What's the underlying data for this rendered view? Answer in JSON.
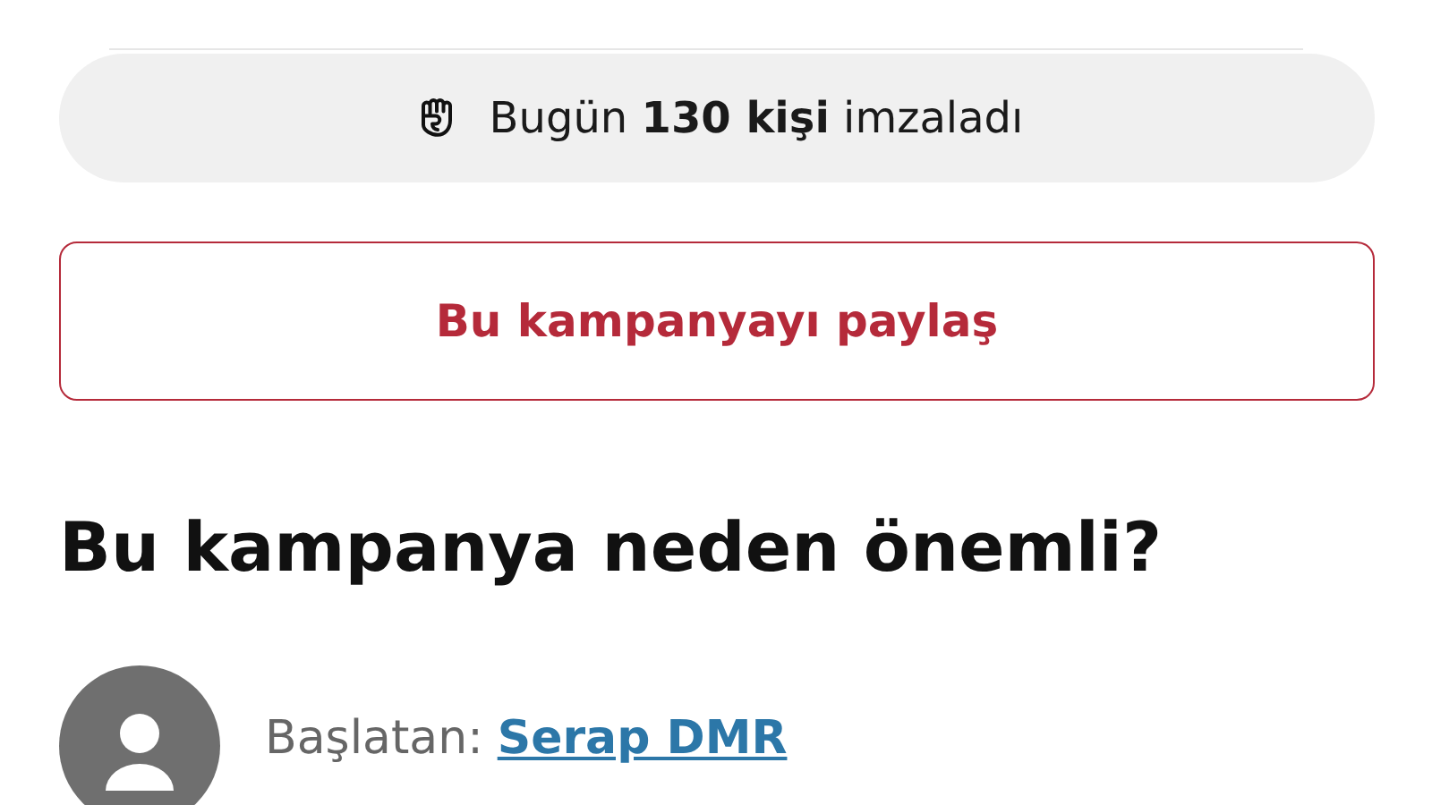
{
  "signatures_today": {
    "text": "Bugün **130 kişi** imzaladı"
  },
  "share_button": {
    "label": "Bu kampanyayı paylaş"
  },
  "section": {
    "title": "Bu kampanya neden önemli?"
  },
  "starter": {
    "label": "Başlatan:",
    "name": "Serap DMR"
  }
}
